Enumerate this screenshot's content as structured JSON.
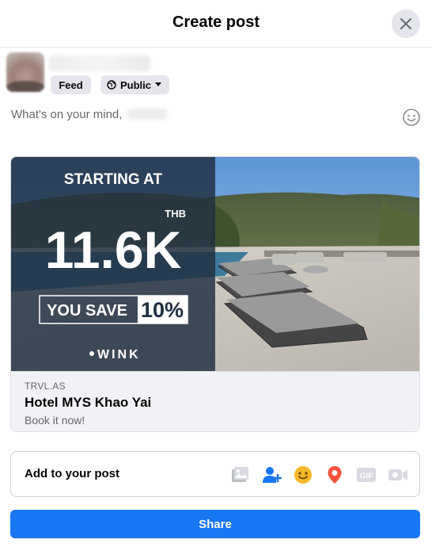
{
  "dialog": {
    "title": "Create post"
  },
  "author": {
    "audience_feed": "Feed",
    "audience_public": "Public"
  },
  "composer": {
    "placeholder": "What's on your mind, "
  },
  "link_preview": {
    "image_text": {
      "starting_at": "STARTING AT",
      "currency": "THB",
      "price": "11.6K",
      "you_save": "YOU SAVE",
      "discount": "10%",
      "brand": "WINK"
    },
    "domain": "TRVL.AS",
    "title": "Hotel MYS Khao Yai",
    "description": "Book it now!"
  },
  "add_to_post": {
    "label": "Add to your post",
    "icons": [
      "photo-video-icon",
      "tag-people-icon",
      "feeling-icon",
      "check-in-icon",
      "gif-icon",
      "live-video-icon"
    ]
  },
  "actions": {
    "share_label": "Share"
  },
  "colors": {
    "accent": "#1877f2",
    "overlay": "#1e2d3f",
    "green": "#45bd62",
    "yellow": "#f7b928",
    "red": "#f5533d",
    "muted_icon": "#bcc0c4"
  }
}
